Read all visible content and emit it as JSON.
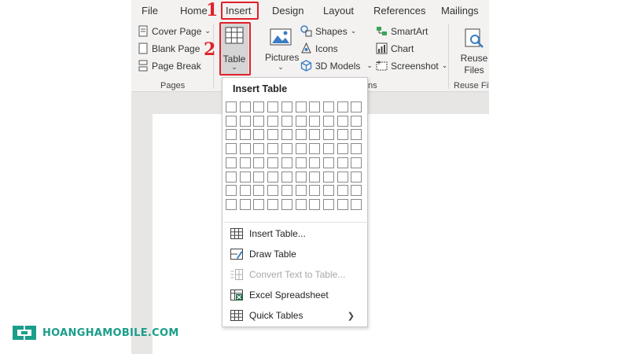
{
  "tabs": {
    "file": "File",
    "home": "Home",
    "insert": "Insert",
    "design": "Design",
    "layout": "Layout",
    "references": "References",
    "mailings": "Mailings"
  },
  "ribbon": {
    "cover_page": "Cover Page",
    "blank_page": "Blank Page",
    "page_break": "Page Break",
    "pages_group": "Pages",
    "table": "Table",
    "pictures": "Pictures",
    "shapes": "Shapes",
    "icons": "Icons",
    "models_3d": "3D Models",
    "smartart": "SmartArt",
    "chart": "Chart",
    "screenshot": "Screenshot",
    "illustrations_group_partial": "ns",
    "reuse_files_line1": "Reuse",
    "reuse_files_line2": "Files",
    "reuse_files_group": "Reuse Fil"
  },
  "steps": {
    "step1": "1",
    "step2": "2"
  },
  "menu": {
    "title": "Insert Table",
    "grid": {
      "columns": 10,
      "rows": 8
    },
    "items": [
      {
        "label": "Insert Table...",
        "icon": "table-icon",
        "enabled": true
      },
      {
        "label": "Draw Table",
        "icon": "draw-table-icon",
        "enabled": true
      },
      {
        "label": "Convert Text to Table...",
        "icon": "convert-text-icon",
        "enabled": false
      },
      {
        "label": "Excel Spreadsheet",
        "icon": "excel-icon",
        "enabled": true
      },
      {
        "label": "Quick Tables",
        "icon": "quick-tables-icon",
        "enabled": true,
        "submenu": true
      }
    ]
  },
  "watermark": {
    "text": "HOANGHAMOBILE.COM"
  },
  "colors": {
    "highlight": "#e0202a",
    "ribbon_bg": "#f3f2f1",
    "brand": "#1a9e8a"
  }
}
